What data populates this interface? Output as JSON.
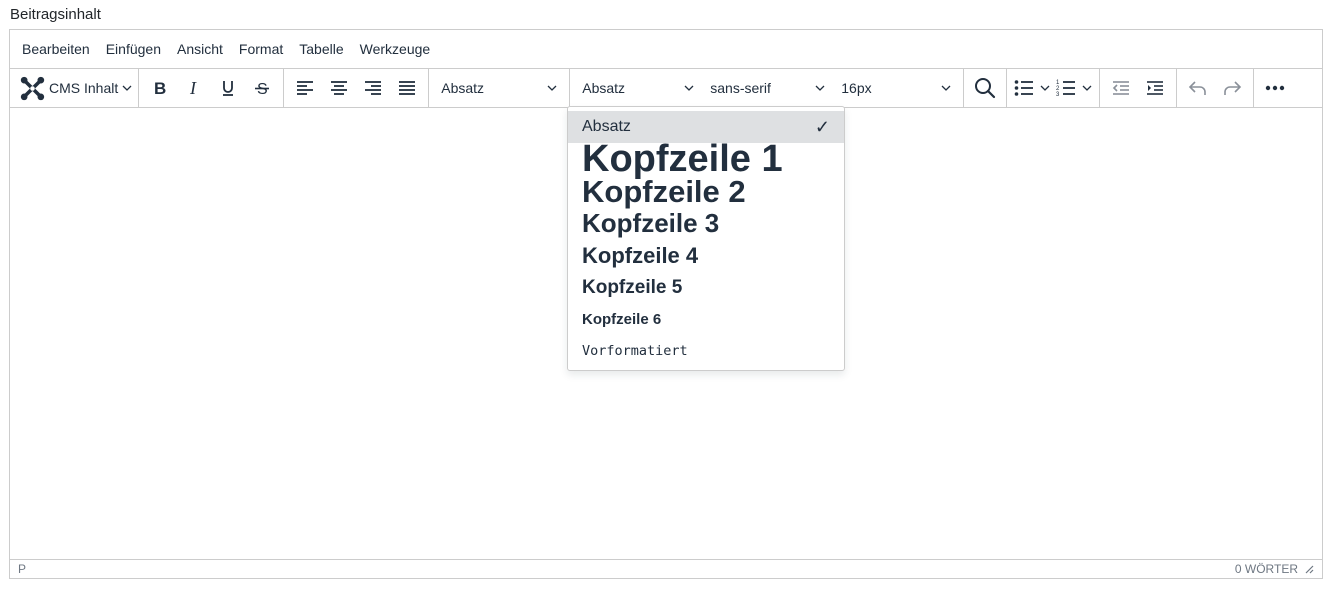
{
  "field": {
    "label": "Beitragsinhalt"
  },
  "menubar": {
    "items": [
      "Bearbeiten",
      "Einfügen",
      "Ansicht",
      "Format",
      "Tabelle",
      "Werkzeuge"
    ]
  },
  "toolbar": {
    "cms_label": "CMS Inhalt",
    "format_select_1": "Absatz",
    "format_select_2": "Absatz",
    "font_family": "sans-serif",
    "font_size": "16px"
  },
  "dropdown": {
    "items": [
      {
        "label": "Absatz",
        "selected": true
      },
      {
        "label": "Kopfzeile 1"
      },
      {
        "label": "Kopfzeile 2"
      },
      {
        "label": "Kopfzeile 3"
      },
      {
        "label": "Kopfzeile 4"
      },
      {
        "label": "Kopfzeile 5"
      },
      {
        "label": "Kopfzeile 6"
      },
      {
        "label": "Vorformatiert"
      }
    ],
    "check_glyph": "✓"
  },
  "statusbar": {
    "path": "P",
    "word_count": "0 WÖRTER"
  },
  "colors": {
    "text": "#222f3e",
    "border": "#cccccc",
    "active_item": "#dee0e2"
  }
}
